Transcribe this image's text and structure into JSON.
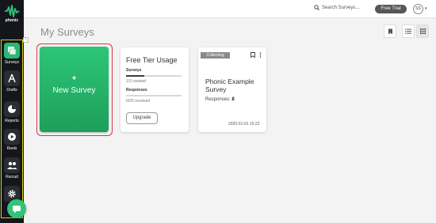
{
  "app": {
    "logo_text": "phonic"
  },
  "sidebar": {
    "collapse_glyph": "‹",
    "items": [
      {
        "label": "Surveys",
        "icon": "surveys-icon",
        "active": true
      },
      {
        "label": "Drafts",
        "icon": "drafts-icon"
      },
      {
        "label": "Reports",
        "icon": "reports-icon"
      },
      {
        "label": "Reels",
        "icon": "reels-icon"
      },
      {
        "label": "Recruit",
        "icon": "recruit-icon"
      },
      {
        "label": "",
        "icon": "gear-icon"
      }
    ]
  },
  "topbar": {
    "search_label": "Search Surveys...",
    "free_trial_label": "Free Trial",
    "avatar_initials": "SS",
    "caret_glyph": "▾"
  },
  "main": {
    "title": "My Surveys",
    "new_survey": {
      "plus": "+",
      "label": "New Survey"
    },
    "usage": {
      "title": "Free Tier Usage",
      "surveys_label": "Surveys",
      "surveys_text": "1/3 created",
      "surveys_fraction": 0.333,
      "responses_label": "Responses",
      "responses_text": "0/25 received",
      "responses_fraction": 0,
      "upgrade_label": "Upgrade"
    },
    "survey": {
      "status": "Collecting",
      "title": "Phonic Example Survey",
      "responses_label": "Responses:",
      "responses_count": "8",
      "date": "2020-01-01 15:22"
    }
  },
  "colors": {
    "accent_green": "#2ab873",
    "sidebar_bg": "#14161b",
    "highlight_red": "#d23b45",
    "highlight_yellow": "#d7d21a"
  }
}
